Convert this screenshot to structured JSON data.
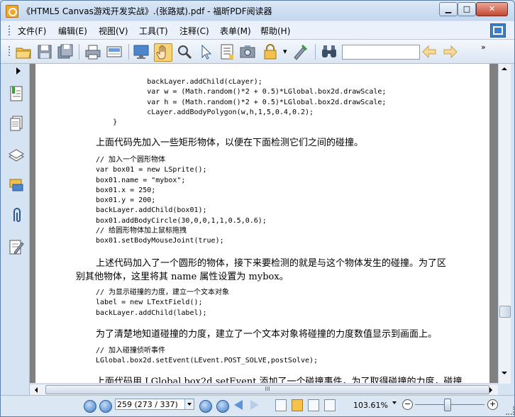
{
  "window": {
    "title": "《HTML5 Canvas游戏开发实战》.(张路斌).pdf - 福昕PDF阅读器",
    "minimize": "▁",
    "maximize": "□",
    "close": "✕"
  },
  "menu": {
    "items": [
      "文件(F)",
      "编辑(E)",
      "视图(V)",
      "工具(T)",
      "注释(C)",
      "表单(M)",
      "帮助(H)"
    ]
  },
  "toolbar": {
    "icons": [
      "open-folder-icon",
      "save-icon",
      "save-as-icon",
      "print-icon",
      "email-icon",
      "fullscreen-icon",
      "hand-tool-icon",
      "zoom-glass-icon",
      "select-arrow-icon",
      "text-select-icon",
      "snapshot-icon",
      "rms-icon",
      "typewriter-icon",
      "find-binoculars-icon",
      "find-prev-icon",
      "find-next-icon"
    ],
    "search_value": "",
    "overflow": "»"
  },
  "sidebar": {
    "icons": [
      "bookmarks-icon",
      "pages-icon",
      "layers-icon",
      "comments-icon",
      "attachments-icon",
      "signatures-icon"
    ]
  },
  "document": {
    "code_block_1": "            backLayer.addChild(cLayer);\n            var w = (Math.random()*2 + 0.5)*LGlobal.box2d.drawScale;\n            var h = (Math.random()*2 + 0.5)*LGlobal.box2d.drawScale;\n            cLayer.addBodyPolygon(w,h,1,5,0.4,0.2);\n    }",
    "para_1": "上面代码先加入一些矩形物体，以便在下面检测它们之间的碰撞。",
    "code_block_2": "// 加入一个圆形物体\nvar box01 = new LSprite();\nbox01.name = \"mybox\";\nbox01.x = 250;\nbox01.y = 200;\nbackLayer.addChild(box01);\nbox01.addBodyCircle(30,0,0,1,1,0.5,0.6);\n// 给圆形物体加上鼠标拖拽\nbox01.setBodyMouseJoint(true);",
    "para_2_line_1": "上述代码加入了一个圆形的物体，接下来要检测的就是与这个物体发生的碰撞。为了区",
    "para_2_line_2": "别其他物体，这里将其 name 属性设置为 mybox。",
    "code_block_3": "// 为显示碰撞的力度，建立一个文本对象\nlabel = new LTextField();\nbackLayer.addChild(label);",
    "para_3": "为了清楚地知道碰撞的力度，建立了一个文本对象将碰撞的力度数值显示到画面上。",
    "code_block_4": "// 加入碰撞侦听事件\nLGlobal.box2d.setEvent(LEvent.POST_SOLVE,postSolve);",
    "para_4": "上面代码用 LGlobal.box2d.setEvent 添加了一个碰撞事件，为了取得碰撞的力度，碰撞"
  },
  "scroll": {
    "h_thumb_grip": "III"
  },
  "status": {
    "page_value": "259 (273 / 337)",
    "zoom": "103.61%",
    "zoom_out": "−",
    "zoom_in": "+",
    "current_page": 259,
    "total_pages": 337,
    "zoom_slider_fraction": 0.43
  },
  "colors": {
    "accent": "#3b78c4",
    "document_bg": "#808080",
    "window_bg": "#d6e3f3"
  }
}
